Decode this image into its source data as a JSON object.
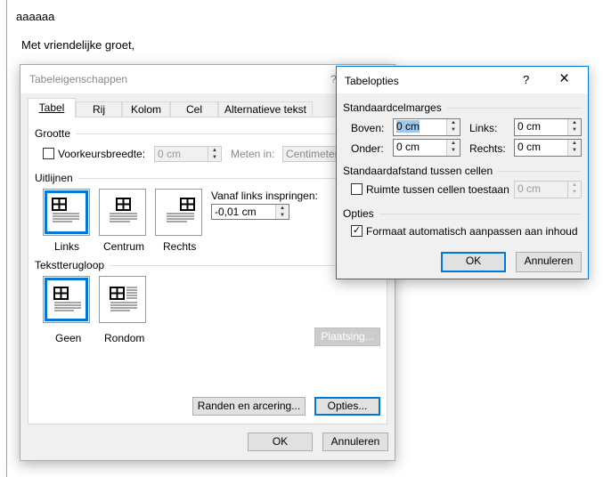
{
  "document": {
    "line1": "aaaaaa",
    "line2": "Met vriendelijke groet,"
  },
  "table_properties": {
    "title": "Tabeleigenschappen",
    "help": "?",
    "tabs": [
      {
        "label": "Tabel"
      },
      {
        "label": "Rij"
      },
      {
        "label": "Kolom"
      },
      {
        "label": "Cel"
      },
      {
        "label": "Alternatieve tekst"
      }
    ],
    "size": {
      "group": "Grootte",
      "preferred_width_label": "Voorkeursbreedte:",
      "preferred_width_checked": false,
      "preferred_width_value": "0 cm",
      "measure_label": "Meten in:",
      "measure_value": "Centimeter"
    },
    "alignment": {
      "group": "Uitlijnen",
      "options": [
        {
          "label": "Links",
          "selected": true
        },
        {
          "label": "Centrum",
          "selected": false
        },
        {
          "label": "Rechts",
          "selected": false
        }
      ],
      "indent_label": "Vanaf links inspringen:",
      "indent_value": "-0,01 cm"
    },
    "wrap": {
      "group": "Tekstterugloop",
      "options": [
        {
          "label": "Geen",
          "selected": true
        },
        {
          "label": "Rondom",
          "selected": false
        }
      ],
      "positioning": "Plaatsing..."
    },
    "borders_button": "Randen en arcering...",
    "options_button": "Opties...",
    "ok": "OK",
    "cancel": "Annuleren"
  },
  "table_options": {
    "title": "Tabelopties",
    "help": "?",
    "close": "×",
    "margins": {
      "group": "Standaardcelmarges",
      "top_label": "Boven:",
      "top_value": "0 cm",
      "bottom_label": "Onder:",
      "bottom_value": "0 cm",
      "left_label": "Links:",
      "left_value": "0 cm",
      "right_label": "Rechts:",
      "right_value": "0 cm"
    },
    "spacing": {
      "group": "Standaardafstand tussen cellen",
      "allow_label": "Ruimte tussen cellen toestaan",
      "allow_checked": false,
      "value": "0 cm"
    },
    "options": {
      "group": "Opties",
      "autofit_label": "Formaat automatisch aanpassen aan inhoud",
      "autofit_checked": true
    },
    "ok": "OK",
    "cancel": "Annuleren"
  }
}
